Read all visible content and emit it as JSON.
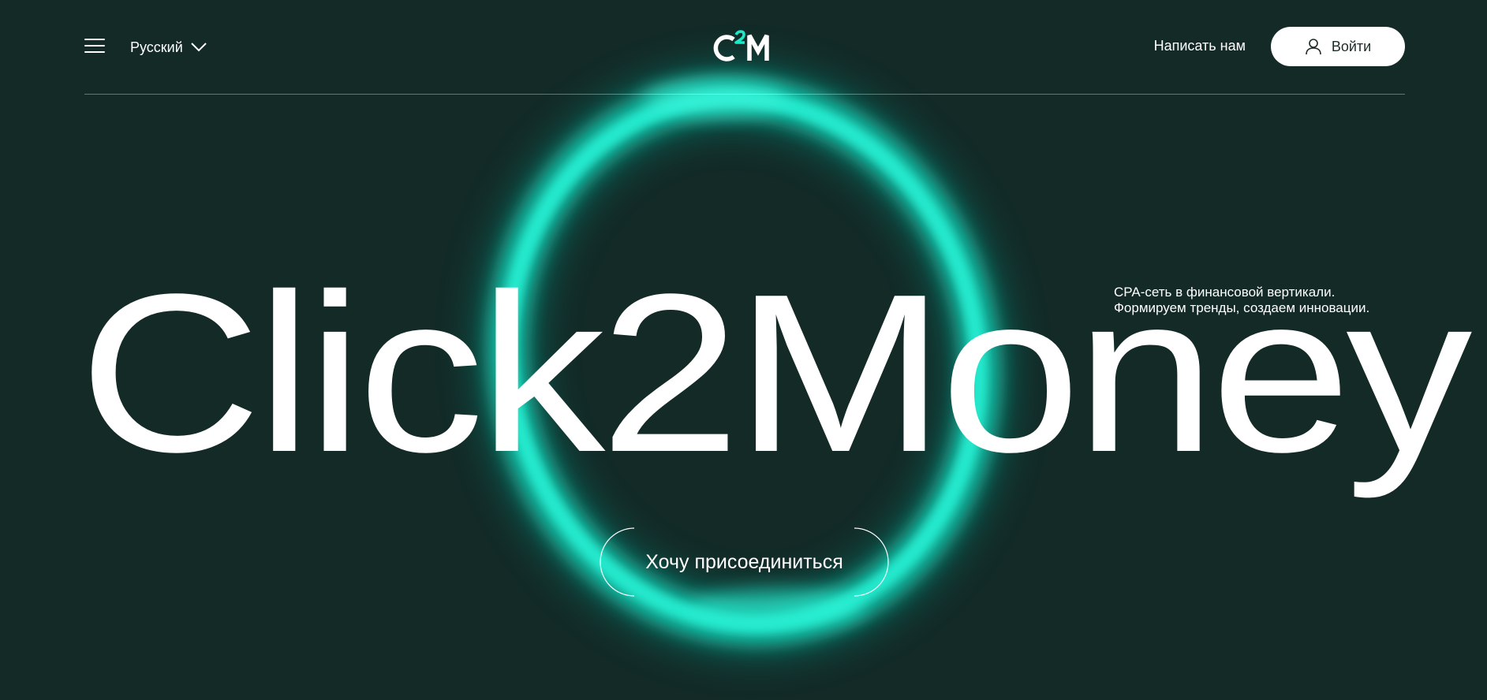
{
  "header": {
    "language": "Русский",
    "logo_text": "C2M",
    "write_us": "Написать нам",
    "login": "Войти"
  },
  "hero": {
    "title": "Click2Money",
    "tagline_line1": "CPA-сеть в финансовой вертикали.",
    "tagline_line2": "Формируем тренды, создаем инновации.",
    "cta": "Хочу присоединиться"
  },
  "icons": {
    "menu": "menu-icon",
    "language_dropdown": "chevron-down-icon",
    "login": "user-icon"
  },
  "colors": {
    "background": "#132a27",
    "accent": "#1de9c9",
    "text": "#ffffff",
    "button_bg": "#ffffff",
    "button_text": "#1d2b29"
  }
}
